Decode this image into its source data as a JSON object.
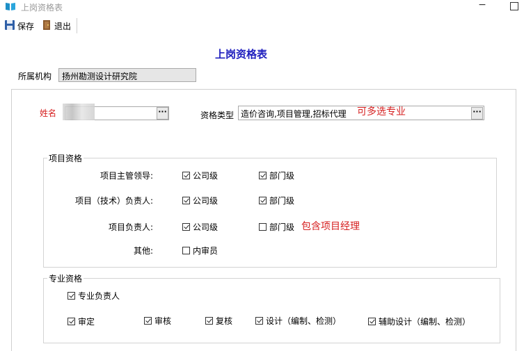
{
  "window": {
    "title": "上岗资格表"
  },
  "toolbar": {
    "save_label": "保存",
    "exit_label": "退出"
  },
  "form": {
    "heading": "上岗资格表",
    "org_label": "所属机构",
    "org_value": "扬州勘测设计研究院",
    "name_label": "姓名",
    "name_value": "",
    "qual_type_label": "资格类型",
    "qual_type_value": "造价咨询,项目管理,招标代理",
    "multi_note": "可多选专业",
    "dots": "···"
  },
  "project_group": {
    "title": "项目资格",
    "rows": [
      {
        "label": "项目主管领导:",
        "company": {
          "label": "公司级",
          "checked": true
        },
        "dept": {
          "label": "部门级",
          "checked": true
        }
      },
      {
        "label": "项目（技术）负责人:",
        "company": {
          "label": "公司级",
          "checked": true
        },
        "dept": {
          "label": "部门级",
          "checked": true
        }
      },
      {
        "label": "项目负责人:",
        "company": {
          "label": "公司级",
          "checked": true
        },
        "dept": {
          "label": "部门级",
          "checked": false
        },
        "note": "包含项目经理"
      }
    ],
    "other_label": "其他:",
    "internal_reviewer": {
      "label": "内审员",
      "checked": false
    }
  },
  "professional_group": {
    "title": "专业资格",
    "lead": {
      "label": "专业负责人",
      "checked": true
    },
    "items": [
      {
        "label": "审定",
        "checked": true
      },
      {
        "label": "审核",
        "checked": true
      },
      {
        "label": "复核",
        "checked": true
      },
      {
        "label": "设计（编制、检测）",
        "checked": true
      },
      {
        "label": "辅助设计（编制、检测）",
        "checked": true
      }
    ]
  }
}
